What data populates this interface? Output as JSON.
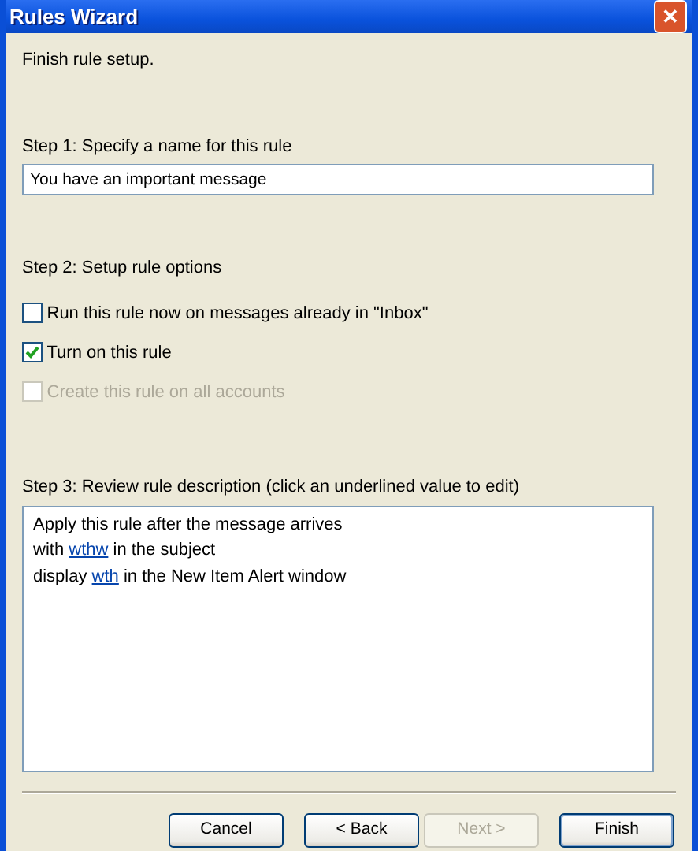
{
  "window": {
    "title": "Rules Wizard",
    "close_label": "✕"
  },
  "heading": "Finish rule setup.",
  "step1": {
    "label": "Step 1: Specify a name for this rule",
    "value": "You have an important message"
  },
  "step2": {
    "label": "Step 2: Setup rule options",
    "options": [
      {
        "label": "Run this rule now on messages already in \"Inbox\"",
        "checked": false,
        "disabled": false
      },
      {
        "label": "Turn on this rule",
        "checked": true,
        "disabled": false
      },
      {
        "label": "Create this rule on all accounts",
        "checked": false,
        "disabled": true
      }
    ]
  },
  "step3": {
    "label": "Step 3: Review rule description (click an underlined value to edit)",
    "lines": [
      [
        {
          "text": "Apply this rule after the message arrives",
          "link": false
        }
      ],
      [
        {
          "text": "with ",
          "link": false
        },
        {
          "text": "wthw",
          "link": true
        },
        {
          "text": " in the subject",
          "link": false
        }
      ],
      [
        {
          "text": "display ",
          "link": false
        },
        {
          "text": "wth",
          "link": true
        },
        {
          "text": " in the New Item Alert window",
          "link": false
        }
      ]
    ]
  },
  "buttons": [
    {
      "label": "Cancel",
      "disabled": false,
      "default": false
    },
    {
      "label": "< Back",
      "disabled": false,
      "default": false
    },
    {
      "label": "Next >",
      "disabled": true,
      "default": false
    },
    {
      "label": "Finish",
      "disabled": false,
      "default": true
    }
  ]
}
